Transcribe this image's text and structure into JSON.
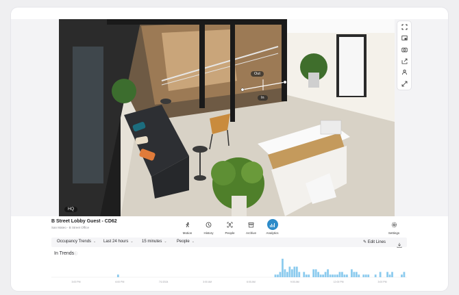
{
  "camera": {
    "title": "B Street Lobby Guest - CD62",
    "subtitle": "San Mateo - B Street Office",
    "quality_badge": "HQ",
    "zone_out_label": "Out",
    "zone_in_label": "In"
  },
  "nav": {
    "items": [
      {
        "label": "Motion",
        "icon": "motion-icon",
        "active": false
      },
      {
        "label": "History",
        "icon": "history-icon",
        "active": false
      },
      {
        "label": "People",
        "icon": "people-icon",
        "active": false
      },
      {
        "label": "Archive",
        "icon": "archive-icon",
        "active": false
      },
      {
        "label": "Analytics",
        "icon": "analytics-icon",
        "active": true
      }
    ],
    "settings_label": "Settings"
  },
  "side_tools": [
    "fullscreen-icon",
    "picture-in-picture-icon",
    "camera-snapshot-icon",
    "share-icon",
    "person-detect-icon",
    "resize-diagonal-icon"
  ],
  "filters": {
    "trend_type": "Occupancy Trends",
    "range": "Last 24 hours",
    "interval": "15 minutes",
    "object": "People",
    "edit_lines": "Edit Lines"
  },
  "section_title": "In Trends",
  "colors": {
    "accent": "#2c8bc9",
    "bar": "#8ccbee"
  },
  "chart_data": {
    "type": "bar",
    "title": "In Trends",
    "x_ticks": [
      "3:00 PM",
      "6:00 PM",
      "7/1/2024",
      "3:00 AM",
      "6:00 AM",
      "9:00 AM",
      "12:00 PM",
      "3:00 PM"
    ],
    "values": [
      0,
      0,
      0,
      0,
      0,
      0,
      0,
      0,
      0,
      0,
      0,
      0,
      0,
      0,
      0,
      0,
      0,
      0,
      0,
      0,
      0,
      0,
      0,
      0,
      0,
      0,
      0,
      1,
      0,
      0,
      0,
      0,
      0,
      0,
      0,
      0,
      0,
      0,
      0,
      0,
      0,
      0,
      0,
      0,
      0,
      0,
      0,
      0,
      0,
      0,
      0,
      0,
      0,
      0,
      0,
      0,
      0,
      0,
      0,
      0,
      0,
      0,
      0,
      0,
      0,
      0,
      0,
      0,
      0,
      0,
      0,
      0,
      0,
      0,
      0,
      0,
      0,
      0,
      0,
      0,
      0,
      0,
      0,
      0,
      0,
      0,
      0,
      0,
      0,
      0,
      0,
      0,
      0,
      1,
      1,
      2,
      7,
      3,
      2,
      4,
      3,
      4,
      4,
      2,
      0,
      2,
      1,
      1,
      0,
      3,
      3,
      2,
      1,
      1,
      2,
      3,
      1,
      1,
      1,
      1,
      2,
      2,
      1,
      1,
      0,
      3,
      2,
      2,
      1,
      0,
      1,
      1,
      1,
      0,
      0,
      1,
      0,
      2,
      0,
      0,
      2,
      1,
      2,
      0,
      0,
      0,
      1,
      2
    ],
    "ylim": [
      0,
      7
    ]
  }
}
